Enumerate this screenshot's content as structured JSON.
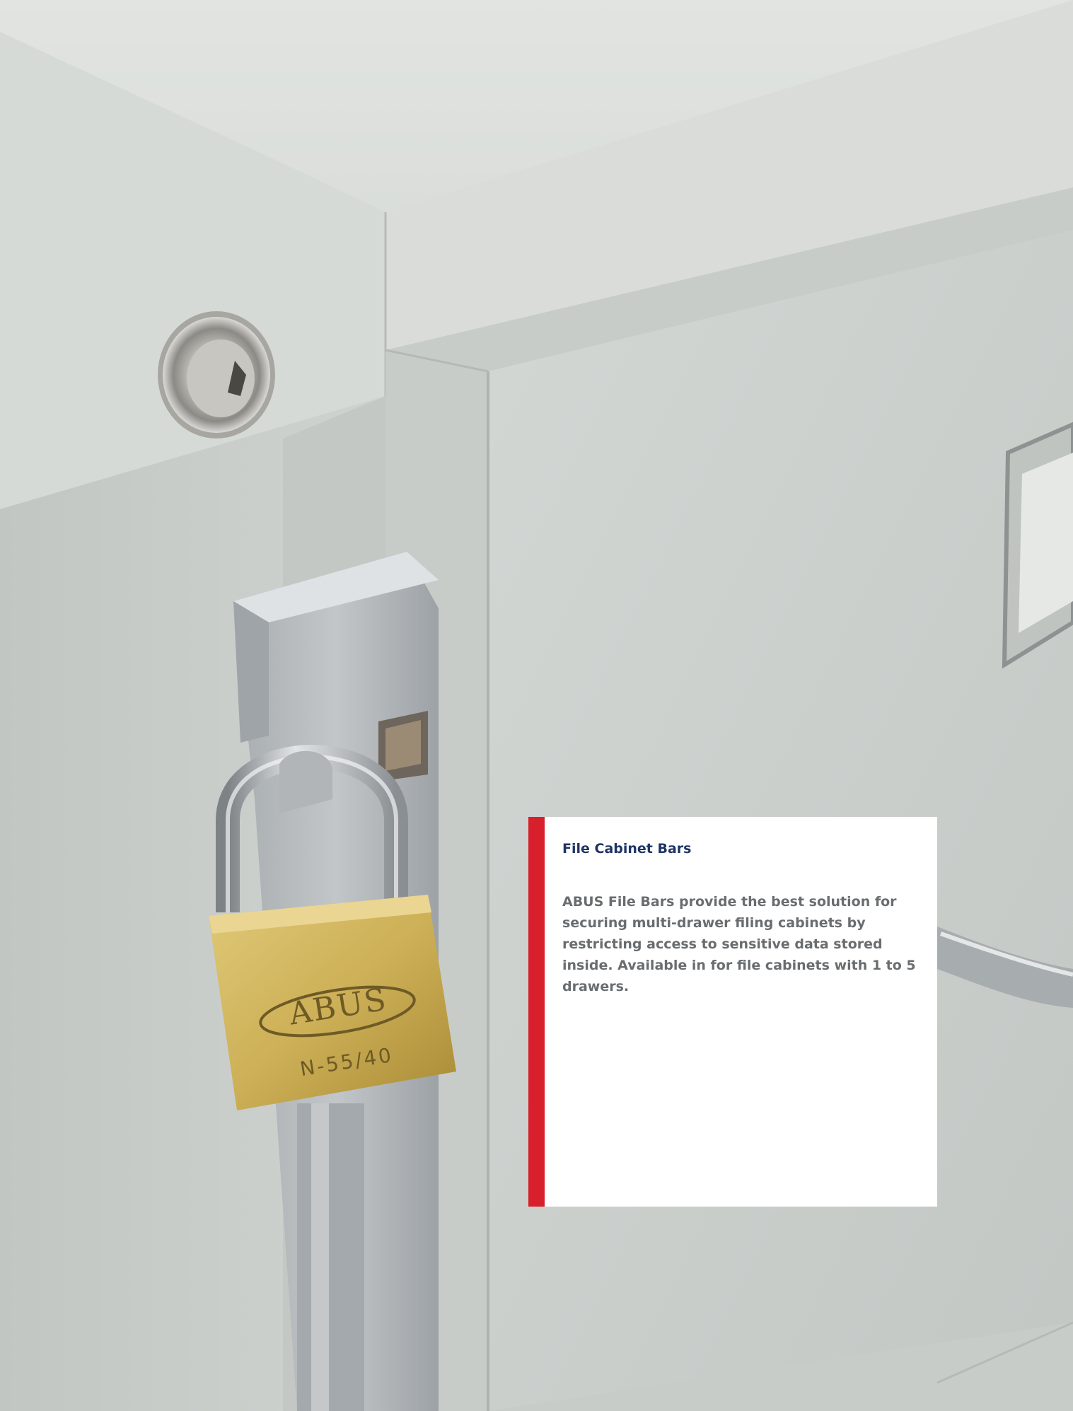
{
  "photo": {
    "padlock_brand": "ABUS",
    "padlock_model": "N-55/40",
    "colors": {
      "cabinet": "#c9ceca",
      "brass": "#cdb057",
      "chrome": "#b9bec2"
    }
  },
  "caption": {
    "title": "File Cabinet Bars",
    "body": "ABUS File Bars provide the best solution for securing multi-drawer filing cabinets by restricting access to sensitive data stored inside. Available in for file cabinets with 1 to 5 drawers.",
    "accent_color": "#d8202c",
    "title_color": "#1f3464"
  }
}
